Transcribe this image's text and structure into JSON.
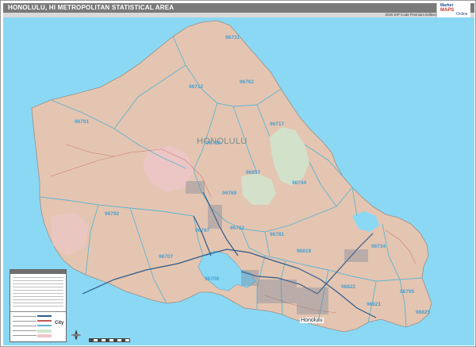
{
  "map": {
    "title": "HONOLULU, HI METROPOLITAN STATISTICAL AREA",
    "edition": "2020 ZIP Code Premium Edition",
    "area_label": "HONOLULU",
    "city_label": "Honolulu",
    "legend_city_word": "City",
    "colors": {
      "ocean": "#8ad8f4",
      "land": "#e4c5b1",
      "land_pink": "#efc6cc",
      "land_green": "#cfe6cf",
      "zip_boundary": "#5fb5cf",
      "zip_label": "#4a9fd1",
      "roads": "#2f5a8a",
      "header": "#7a7a7a"
    },
    "logo": {
      "word1": "Market",
      "word2": "MAPS",
      "word3": "Online"
    },
    "zip_codes": [
      "96731",
      "96712",
      "96762",
      "96791",
      "96717",
      "96786",
      "96857",
      "96744",
      "96789",
      "96792",
      "96797",
      "96782",
      "96781",
      "96819",
      "96734",
      "96707",
      "96706",
      "96822",
      "96795",
      "96821",
      "96825"
    ]
  }
}
